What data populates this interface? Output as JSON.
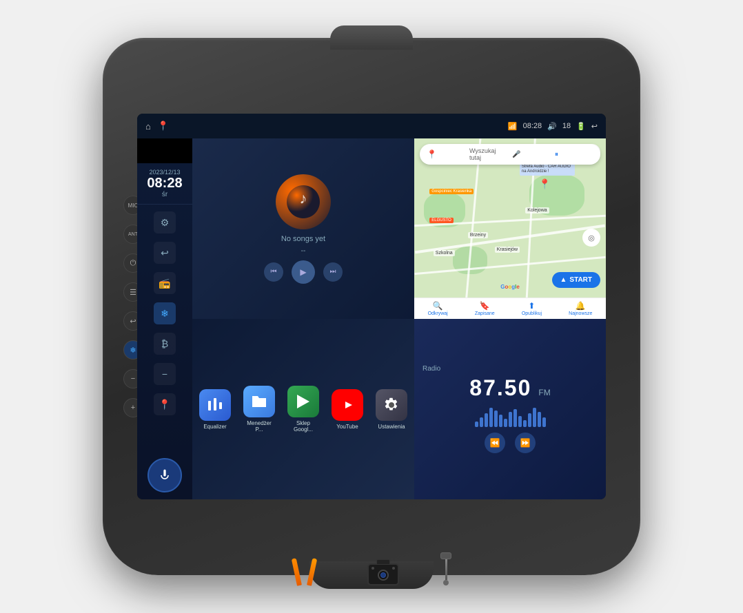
{
  "device": {
    "title": "Car Android Head Unit"
  },
  "status_bar": {
    "wifi_icon": "wifi",
    "time": "08:28",
    "volume_icon": "volume",
    "volume_level": "18",
    "battery_icon": "battery",
    "back_icon": "back",
    "nav_icon_1": "home",
    "nav_icon_2": "map"
  },
  "datetime": {
    "date": "2023/12/13",
    "time": "08:28",
    "day": "śr"
  },
  "sidebar": {
    "power_label": "power",
    "settings_label": "settings",
    "back_label": "back",
    "radio_label": "radio",
    "snow_label": "snow",
    "bluetooth_label": "bluetooth",
    "vol_down_label": "vol-down",
    "vol_up_label": "vol-up",
    "location_label": "location",
    "mic_label": "microphone"
  },
  "music": {
    "no_songs_text": "No songs yet",
    "dash": "--",
    "prev_icon": "prev",
    "play_icon": "play",
    "next_icon": "next"
  },
  "map": {
    "search_placeholder": "Wyszukaj tutaj",
    "mic_icon": "mic",
    "start_button": "START",
    "location_label": "Strefa Audio - CAR AUDIO na Androidzie !",
    "label_goscieniec": "Gospciniec Krasienka",
    "label_elgusto": "ELGUSTO",
    "label_brzeiny": "Brzeiny",
    "label_szkola": "Szkolna",
    "label_krasiejow": "Krasiejów",
    "label_kolejowa": "Kolejowa",
    "copyright": "©2023 Google",
    "nav_odkrywaj": "Odkrywaj",
    "nav_zapisane": "Zapisane",
    "nav_opublikuj": "Opublikuj",
    "nav_najnowsze": "Najnowsze"
  },
  "apps": [
    {
      "id": "equalizer",
      "label": "Equalizer",
      "icon": "🎛",
      "class": "app-equalizer"
    },
    {
      "id": "files",
      "label": "Menedżer P...",
      "icon": "📁",
      "class": "app-files"
    },
    {
      "id": "play",
      "label": "Sklep Googl...",
      "icon": "▶",
      "class": "app-play"
    },
    {
      "id": "youtube",
      "label": "YouTube",
      "icon": "▶",
      "class": "app-youtube"
    },
    {
      "id": "settings",
      "label": "Ustawienia",
      "icon": "⚙",
      "class": "app-settings"
    }
  ],
  "radio": {
    "label": "Radio",
    "frequency": "87.50",
    "band": "FM",
    "prev_icon": "rewind",
    "next_icon": "fast-forward",
    "wave_heights": [
      8,
      14,
      20,
      28,
      24,
      18,
      12,
      22,
      26,
      16,
      10,
      20,
      28,
      22,
      14
    ]
  },
  "accessories": [
    {
      "id": "tools",
      "label": "pry tools"
    },
    {
      "id": "camera",
      "label": "rear camera"
    },
    {
      "id": "connector",
      "label": "connector cable"
    }
  ]
}
